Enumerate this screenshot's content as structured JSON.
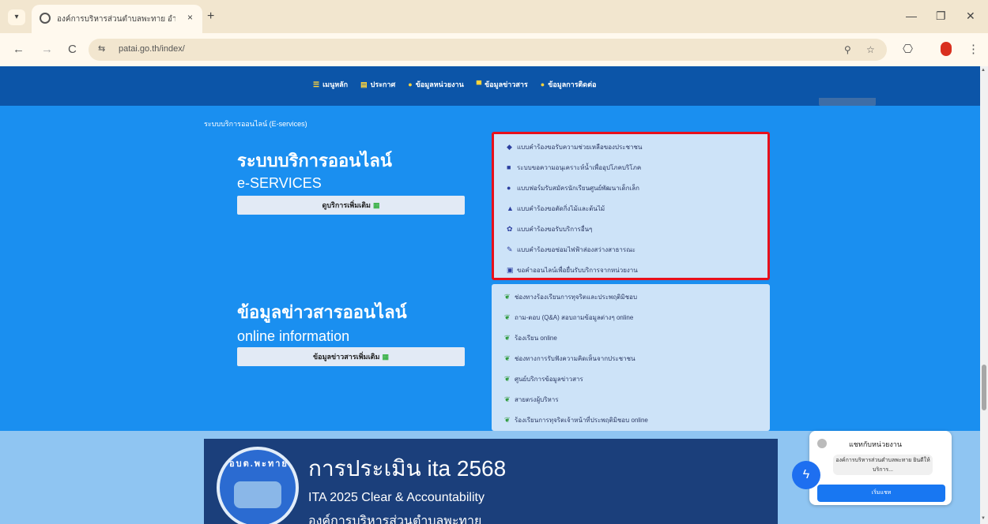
{
  "browser": {
    "tab_title": "องค์การบริหารส่วนตำบลพะทาย อำเภอ...",
    "url": "patai.go.th/index/",
    "tab_close": "×",
    "new_tab": "+",
    "menu_glyph": "▾",
    "back_glyph": "←",
    "forward_glyph": "→",
    "reload_glyph": "C",
    "zoom_glyph": "⚲",
    "star_glyph": "☆",
    "puzzle_glyph": "⎔",
    "more_glyph": "⋮",
    "minimize_glyph": "—",
    "restore_glyph": "❐",
    "close_glyph": "✕",
    "site_info_glyph": "⇆"
  },
  "topnav": {
    "items": [
      {
        "icon": "☰",
        "label": "เมนูหลัก"
      },
      {
        "icon": "▤",
        "label": "ประกาศ"
      },
      {
        "icon": "●",
        "label": "ข้อมูลหน่วยงาน"
      },
      {
        "icon": "▀",
        "label": "ข้อมูลข่าวสาร"
      },
      {
        "icon": "●",
        "label": "ข้อมูลการติดต่อ"
      }
    ]
  },
  "eservices": {
    "section_label": "ระบบบริการออนไลน์ (E-services)",
    "heading_th": "ระบบบริการออนไลน์",
    "heading_en": "e-SERVICES",
    "more_button": "ดูบริการเพิ่มเติม",
    "more_glyph": "▦",
    "items": [
      {
        "icon": "◆",
        "color": "#2c3fa0",
        "label": "แบบคำร้องขอรับความช่วยเหลือของประชาชน"
      },
      {
        "icon": "■",
        "color": "#2c3fa0",
        "label": "ระบบขอความอนุเคราะห์น้ำเพื่ออุปโภคบริโภค"
      },
      {
        "icon": "●",
        "color": "#2c3fa0",
        "label": "แบบฟอร์มรับสมัครนักเรียนศูนย์พัฒนาเด็กเล็ก"
      },
      {
        "icon": "▲",
        "color": "#2c3fa0",
        "label": "แบบคำร้องขอตัดกิ่งไม้และต้นไม้"
      },
      {
        "icon": "✿",
        "color": "#2c3fa0",
        "label": "แบบคำร้องขอรับบริการอื่นๆ"
      },
      {
        "icon": "✎",
        "color": "#2c3fa0",
        "label": "แบบคำร้องขอซ่อมไฟฟ้าส่องสว่างสาธารณะ"
      },
      {
        "icon": "▣",
        "color": "#2c3fa0",
        "label": "ขอคำออนไลน์เพื่อยื่นรับบริการจากหน่วยงาน"
      }
    ]
  },
  "online_info": {
    "heading_th": "ข้อมูลข่าวสารออนไลน์",
    "heading_en": "online information",
    "more_button": "ข้อมูลข่าวสารเพิ่มเติม",
    "more_glyph": "▦",
    "items": [
      {
        "icon": "❦",
        "color": "#2f9a3d",
        "label": "ช่องทางร้องเรียนการทุจริตและประพฤติมิชอบ"
      },
      {
        "icon": "❦",
        "color": "#2f9a3d",
        "label": "ถาม-ตอบ (Q&A) สอบถามข้อมูลต่างๆ online"
      },
      {
        "icon": "❦",
        "color": "#2f9a3d",
        "label": "ร้องเรียน online"
      },
      {
        "icon": "❦",
        "color": "#2f9a3d",
        "label": "ช่องทางการรับฟังความคิดเห็นจากประชาชน"
      },
      {
        "icon": "❦",
        "color": "#2f9a3d",
        "label": "ศูนย์บริการข้อมูลข่าวสาร"
      },
      {
        "icon": "❦",
        "color": "#2f9a3d",
        "label": "สายตรงผู้บริหาร"
      },
      {
        "icon": "❦",
        "color": "#2f9a3d",
        "label": "ร้องเรียนการทุจริตเจ้าหน้าที่ประพฤติมิชอบ online"
      }
    ]
  },
  "ita_banner": {
    "seal_text": "อบต.พะทาย",
    "title": "การประเมิน ita 2568",
    "subtitle": "ITA 2025 Clear & Accountability",
    "subtitle2": "องค์การบริหารส่วนตำบลพะทาย"
  },
  "chat": {
    "title": "แชทกับหน่วยงาน",
    "message": "องค์การบริหารส่วนตำบลพะทาย ยินดีให้บริการ...",
    "button": "เริ่มแชท",
    "messenger_glyph": "ϟ"
  },
  "scrollbar": {
    "up": "▲",
    "down": "▼"
  },
  "colors": {
    "highlight_border": "#e8101b",
    "page_bg": "#1a8ff0",
    "nav_bg": "#0c55a8"
  }
}
